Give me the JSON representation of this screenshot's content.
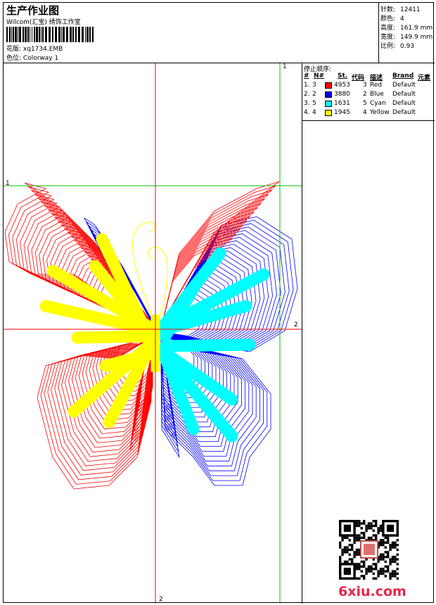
{
  "header": {
    "title": "生产作业图",
    "company": "Wilcom(汇宝) 绣饰工作室",
    "design_label": "花版:",
    "design_value": "xq1734.EMB",
    "colorway_label": "色位:",
    "colorway_value": "Colorway 1"
  },
  "stats": [
    {
      "label": "针数:",
      "value": "12411"
    },
    {
      "label": "颜色:",
      "value": "4"
    },
    {
      "label": "高度:",
      "value": "161.9 mm"
    },
    {
      "label": "宽度:",
      "value": "149.9 mm"
    },
    {
      "label": "比例:",
      "value": "0.93"
    }
  ],
  "stop_sequence": {
    "title": "停止顺序:",
    "headers": [
      "#",
      "N#",
      "St.",
      "代码",
      "描述",
      "Brand",
      "元素"
    ],
    "rows": [
      {
        "num": "1.",
        "n": "3",
        "color": "#ff0000",
        "stitches": "4953",
        "code": "3",
        "desc": "Red",
        "brand": "Default"
      },
      {
        "num": "2.",
        "n": "2",
        "color": "#0000ff",
        "stitches": "3880",
        "code": "2",
        "desc": "Blue",
        "brand": "Default"
      },
      {
        "num": "3.",
        "n": "5",
        "color": "#00ffff",
        "stitches": "1631",
        "code": "5",
        "desc": "Cyan",
        "brand": "Default"
      },
      {
        "num": "4.",
        "n": "4",
        "color": "#ffff00",
        "stitches": "1945",
        "code": "4",
        "desc": "Yellow",
        "brand": "Default"
      }
    ]
  },
  "guides": {
    "top_marker": "1",
    "left_marker": "1",
    "right_marker": "2",
    "bottom_marker": "2",
    "green": "#00c000",
    "red": "#ff0000"
  },
  "colors": {
    "red": "#ff0000",
    "blue": "#0000ff",
    "cyan": "#00ffff",
    "yellow": "#ffff00"
  },
  "watermark": "6xiu.com"
}
